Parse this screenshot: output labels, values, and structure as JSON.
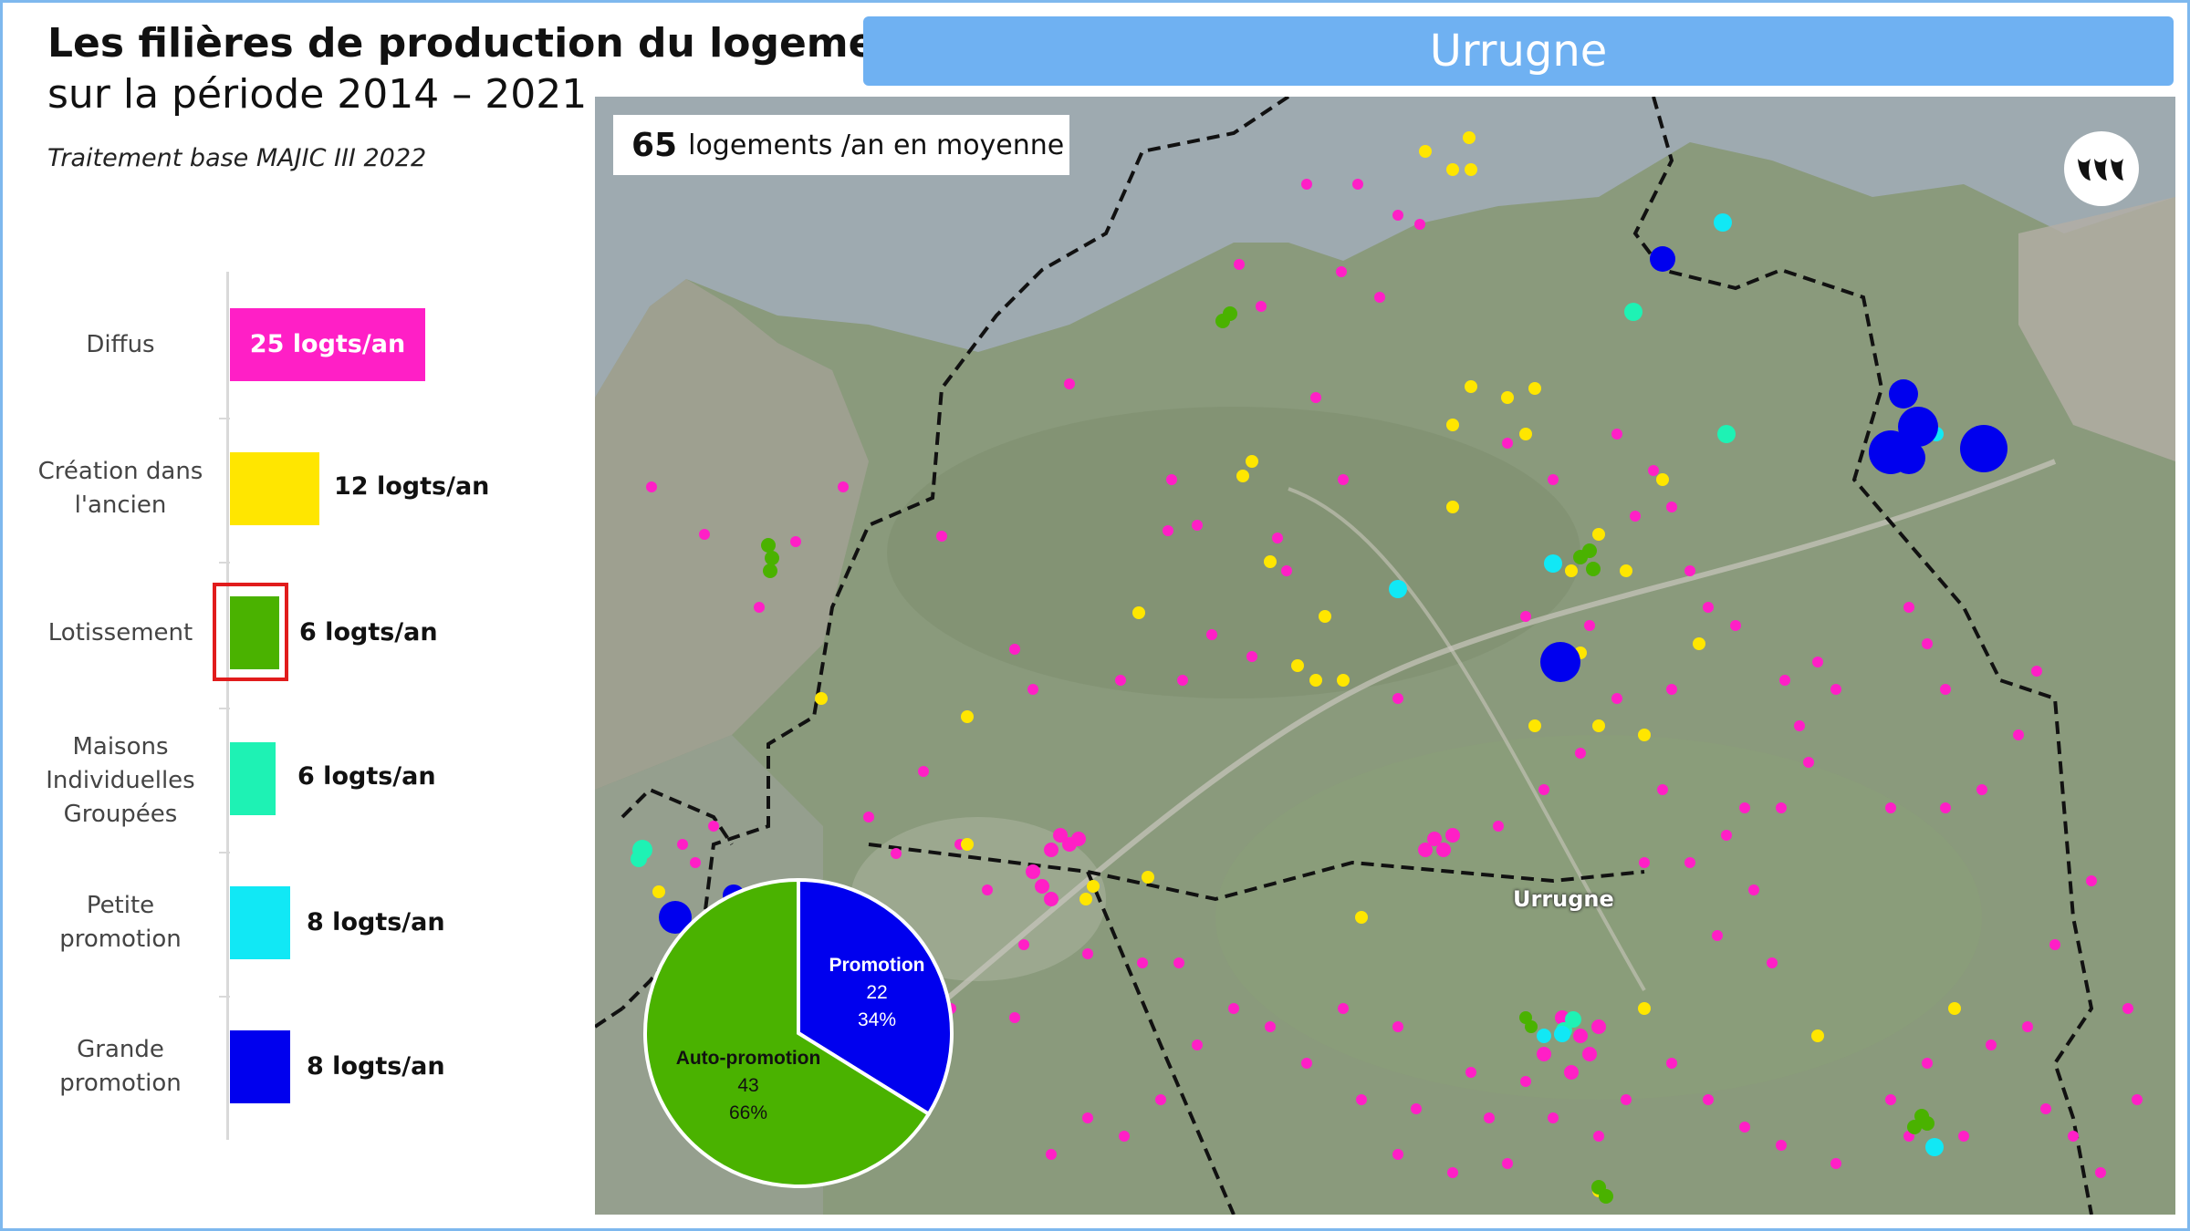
{
  "header": {
    "title_line1": "Les filières de production du logement",
    "title_line2": "sur la période 2014 – 2021",
    "subtitle": "Traitement base MAJIC III 2022",
    "commune": "Urrugne"
  },
  "colors": {
    "diffus": "#ff1fc6",
    "creation_ancien": "#ffe600",
    "lotissement": "#4ab200",
    "maisons_groupees": "#1ef2b4",
    "petite_promotion": "#11e8f5",
    "grande_promotion": "#0000ee",
    "banner": "#6fb1f2",
    "highlight": "#e11c1c"
  },
  "chart_data": [
    {
      "type": "bar",
      "orientation": "horizontal",
      "categories": [
        "Diffus",
        "Création dans l'ancien",
        "Lotissement",
        "Maisons Individuelles Groupées",
        "Petite promotion",
        "Grande promotion"
      ],
      "values": [
        25,
        12,
        6,
        6,
        8,
        8
      ],
      "value_labels": [
        "25 logts/an",
        "12 logts/an",
        "6 logts/an",
        "6 logts/an",
        "8 logts/an",
        "8 logts/an"
      ],
      "unit": "logts/an",
      "highlighted_category": "Lotissement"
    },
    {
      "type": "pie",
      "slices": [
        {
          "name": "Promotion",
          "value": 22,
          "percent": "34%"
        },
        {
          "name": "Auto-promotion",
          "value": 43,
          "percent": "66%"
        }
      ]
    }
  ],
  "bars": [
    {
      "label_lines": [
        "Diffus"
      ],
      "value_label": "25 logts/an"
    },
    {
      "label_lines": [
        "Création dans",
        "l'ancien"
      ],
      "value_label": "12 logts/an"
    },
    {
      "label_lines": [
        "Lotissement"
      ],
      "value_label": "6 logts/an"
    },
    {
      "label_lines": [
        "Maisons",
        "Individuelles",
        "Groupées"
      ],
      "value_label": "6 logts/an"
    },
    {
      "label_lines": [
        "Petite",
        "promotion"
      ],
      "value_label": "8 logts/an"
    },
    {
      "label_lines": [
        "Grande",
        "promotion"
      ],
      "value_label": "8 logts/an"
    }
  ],
  "map": {
    "info_number": "65",
    "info_text": "logements /an en moyenne",
    "town_label": "Urrugne",
    "pie": {
      "promotion": {
        "name": "Promotion",
        "value": "22",
        "percent": "34%"
      },
      "auto": {
        "name": "Auto-promotion",
        "value": "43",
        "percent": "66%"
      }
    }
  }
}
